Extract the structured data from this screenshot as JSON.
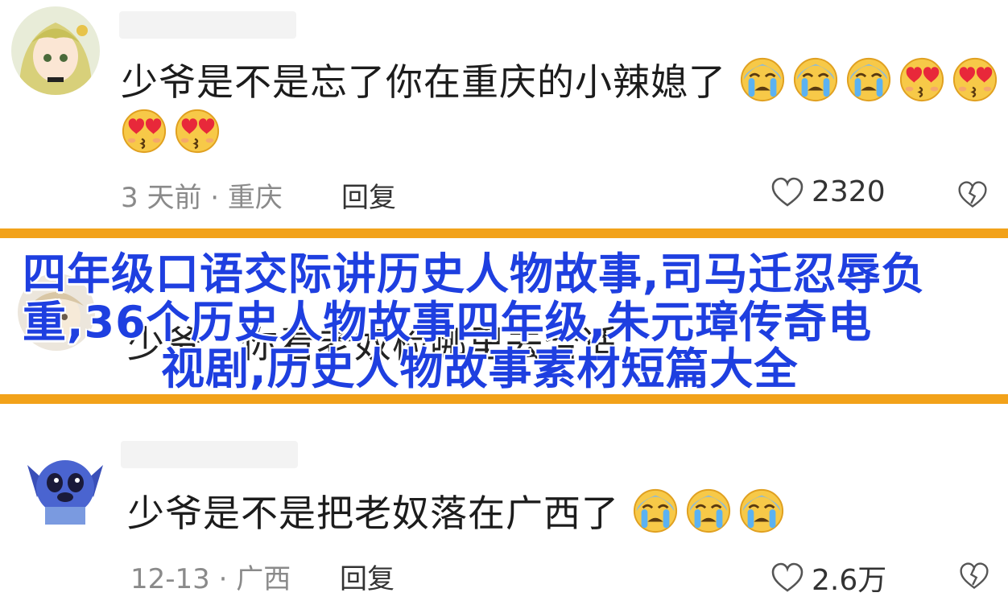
{
  "comments": [
    {
      "text_line1": "少爷是不是忘了你在重庆的小辣媳了",
      "text_line2": "",
      "meta": "3 天前 · 重庆",
      "reply_label": "回复",
      "likes": "2320"
    },
    {
      "text": "少爷，你看老奴检哪里去合适"
    },
    {
      "text": "少爷是不是把老奴落在广西了",
      "meta": "12-13 · 广西",
      "reply_label": "回复",
      "likes": "2.6万"
    }
  ],
  "banner": {
    "line1": "四年级口语交际讲历史人物故事,司马迁忍辱负",
    "line2": "重,36个历史人物故事四年级,朱元璋传奇电",
    "line3": "视剧,历史人物故事素材短篇大全"
  },
  "colors": {
    "divider": "#f2a21a",
    "banner_text": "#1e3fe0"
  },
  "icons": [
    "heart-outline-icon",
    "broken-heart-icon",
    "crying-face-emoji",
    "heart-eyes-emoji"
  ]
}
